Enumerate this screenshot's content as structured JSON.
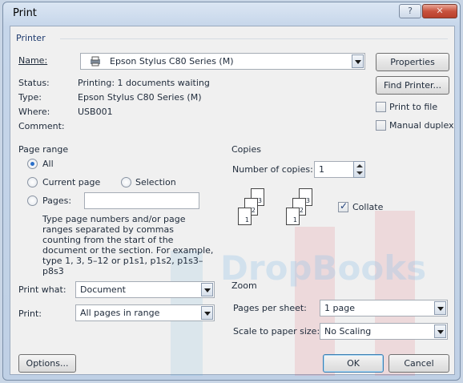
{
  "window": {
    "title": "Print",
    "help_glyph": "?",
    "close_glyph": "✕"
  },
  "printer": {
    "section": "Printer",
    "name_label": "Name:",
    "name_value": "Epson Stylus C80 Series (M)",
    "properties": "Properties",
    "status_label": "Status:",
    "status_value": "Printing: 1 documents waiting",
    "type_label": "Type:",
    "type_value": "Epson Stylus C80 Series (M)",
    "where_label": "Where:",
    "where_value": "USB001",
    "comment_label": "Comment:",
    "find_printer": "Find Printer...",
    "print_to_file": "Print to file",
    "manual_duplex": "Manual duplex"
  },
  "page_range": {
    "section": "Page range",
    "all": "All",
    "current_page": "Current page",
    "selection": "Selection",
    "pages": "Pages:",
    "pages_value": "",
    "help": "Type page numbers and/or page ranges separated by commas counting from the start of the document or the section. For example, type 1, 3, 5–12 or p1s1, p1s2, p1s3–p8s3"
  },
  "copies": {
    "section": "Copies",
    "number_label": "Number of copies:",
    "number_value": "1",
    "collate": "Collate",
    "sheet_labels": [
      "1",
      "2",
      "3"
    ]
  },
  "print_what": {
    "label": "Print what:",
    "value": "Document"
  },
  "print": {
    "label": "Print:",
    "value": "All pages in range"
  },
  "zoom": {
    "section": "Zoom",
    "pages_per_sheet_label": "Pages per sheet:",
    "pages_per_sheet_value": "1 page",
    "scale_label": "Scale to paper size:",
    "scale_value": "No Scaling"
  },
  "buttons": {
    "options": "Options...",
    "ok": "OK",
    "cancel": "Cancel"
  },
  "watermark": {
    "text": "DropBooks"
  },
  "colors": {
    "title_bar": "#c6d6ea",
    "close_button": "#c8523d",
    "watermark": "#e03a4a",
    "section_text": "#1e3a6e"
  }
}
